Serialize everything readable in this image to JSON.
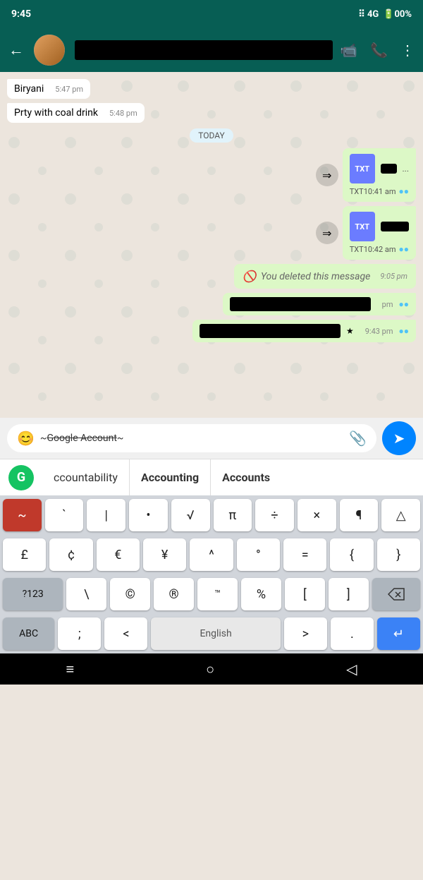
{
  "status_bar": {
    "time": "9:45",
    "signal": "4G",
    "battery": "00%"
  },
  "header": {
    "back_label": "←",
    "video_icon": "📹",
    "phone_icon": "📞",
    "more_icon": "⋮"
  },
  "messages": [
    {
      "id": "msg1",
      "type": "incoming_simple",
      "text": "Biryani",
      "time": "5:47 pm"
    },
    {
      "id": "msg2",
      "type": "incoming_simple",
      "text": "Prty with coal drink",
      "time": "5:48 pm"
    },
    {
      "id": "date_badge",
      "type": "date",
      "text": "TODAY"
    },
    {
      "id": "msg3",
      "type": "outgoing_file",
      "filename_label": "TXT",
      "time": "10:41 am"
    },
    {
      "id": "msg4",
      "type": "outgoing_file",
      "filename_label": "TXT",
      "time": "10:42 am"
    },
    {
      "id": "msg5",
      "type": "outgoing_deleted",
      "text": "You deleted this message",
      "time": "9:05 pm"
    },
    {
      "id": "msg6",
      "type": "outgoing_redacted",
      "time": "pm"
    },
    {
      "id": "msg7",
      "type": "outgoing_redacted2",
      "time": "9:43 pm"
    }
  ],
  "input": {
    "emoji_icon": "😊",
    "text": "~Google Account~",
    "attach_icon": "📎",
    "send_icon": "➤"
  },
  "autocomplete": {
    "grammarly_letter": "G",
    "words": [
      "ccountability",
      "Accounting",
      "Accounts"
    ]
  },
  "keyboard": {
    "rows": [
      [
        "~",
        "`",
        "|",
        "•",
        "√",
        "π",
        "÷",
        "×",
        "¶",
        "△"
      ],
      [
        "£",
        "¢",
        "€",
        "¥",
        "^",
        "°",
        "=",
        "{",
        "}"
      ],
      [
        "?123",
        "\\",
        "©",
        "®",
        "™",
        "%",
        "[",
        "]",
        "⌫"
      ],
      [
        "ABC",
        ";",
        "<",
        "English",
        ">",
        ".",
        "↵"
      ]
    ]
  },
  "bottom_nav": {
    "menu_icon": "≡",
    "home_icon": "○",
    "back_icon": "◁"
  }
}
